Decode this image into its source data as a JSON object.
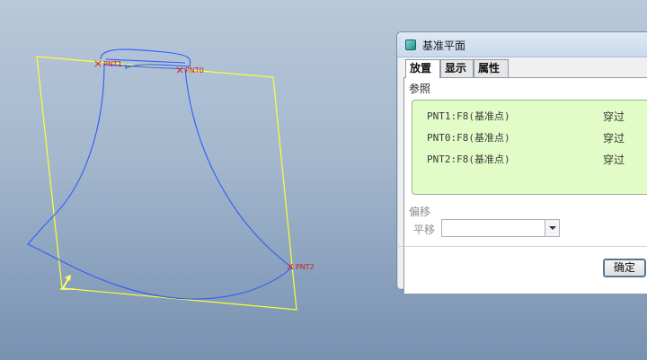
{
  "viewport": {
    "points": [
      {
        "name": "PNT1"
      },
      {
        "name": "PNT0"
      },
      {
        "name": "PNT2"
      }
    ],
    "colors": {
      "plane": "#ffff33",
      "curve": "#2f5bff",
      "point": "#e02020"
    }
  },
  "dialog": {
    "title": "基准平面",
    "icon": "datum-plane-icon",
    "tabs": [
      {
        "label": "放置"
      },
      {
        "label": "显示"
      },
      {
        "label": "属性"
      }
    ],
    "references_label": "参照",
    "references": [
      {
        "name": "PNT1:F8(基准点)",
        "type": "穿过"
      },
      {
        "name": "PNT0:F8(基准点)",
        "type": "穿过"
      },
      {
        "name": "PNT2:F8(基准点)",
        "type": "穿过"
      }
    ],
    "offset_label": "偏移",
    "translate_label": "平移",
    "translate_value": "",
    "ok_label": "确定"
  }
}
